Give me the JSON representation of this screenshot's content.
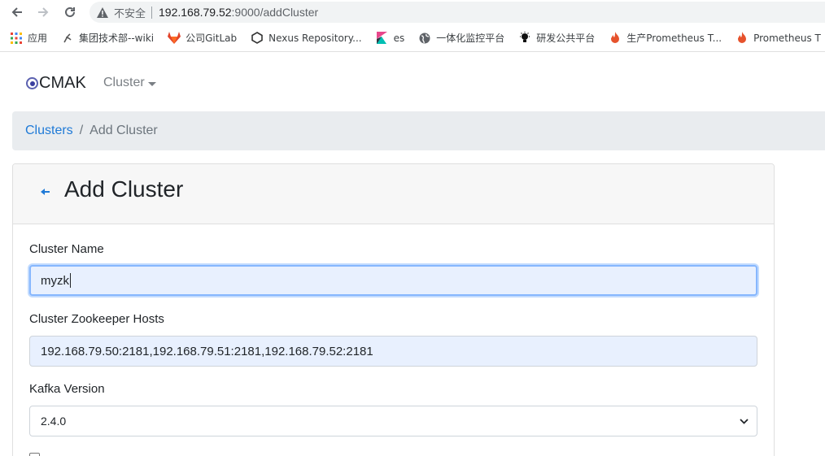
{
  "browser": {
    "insecure_label": "不安全",
    "url_host": "192.168.79.52",
    "url_path": ":9000/addCluster",
    "bookmarks": [
      {
        "label": "应用",
        "icon": "apps-grid-icon"
      },
      {
        "label": "集团技术部--wiki",
        "icon": "wiki-icon"
      },
      {
        "label": "公司GitLab",
        "icon": "gitlab-icon"
      },
      {
        "label": "Nexus Repository...",
        "icon": "nexus-icon"
      },
      {
        "label": "es",
        "icon": "kibana-icon"
      },
      {
        "label": "一体化监控平台",
        "icon": "globe-icon"
      },
      {
        "label": "研发公共平台",
        "icon": "bulb-icon"
      },
      {
        "label": "生产Prometheus T...",
        "icon": "prometheus-icon"
      },
      {
        "label": "Prometheus T",
        "icon": "prometheus-icon"
      }
    ]
  },
  "navbar": {
    "brand": "CMAK",
    "cluster_menu": "Cluster"
  },
  "breadcrumb": {
    "link": "Clusters",
    "divider": "/",
    "active": "Add Cluster"
  },
  "form": {
    "title": "Add Cluster",
    "cluster_name_label": "Cluster Name",
    "cluster_name_value": "myzk",
    "zk_hosts_label": "Cluster Zookeeper Hosts",
    "zk_hosts_value": "192.168.79.50:2181,192.168.79.51:2181,192.168.79.52:2181",
    "kafka_version_label": "Kafka Version",
    "kafka_version_value": "2.4.0"
  },
  "colors": {
    "link": "#1f7ad7",
    "breadcrumb_bg": "#e9ecef",
    "autofill_bg": "#e8f0fe",
    "focus_border": "#86b7fe"
  }
}
